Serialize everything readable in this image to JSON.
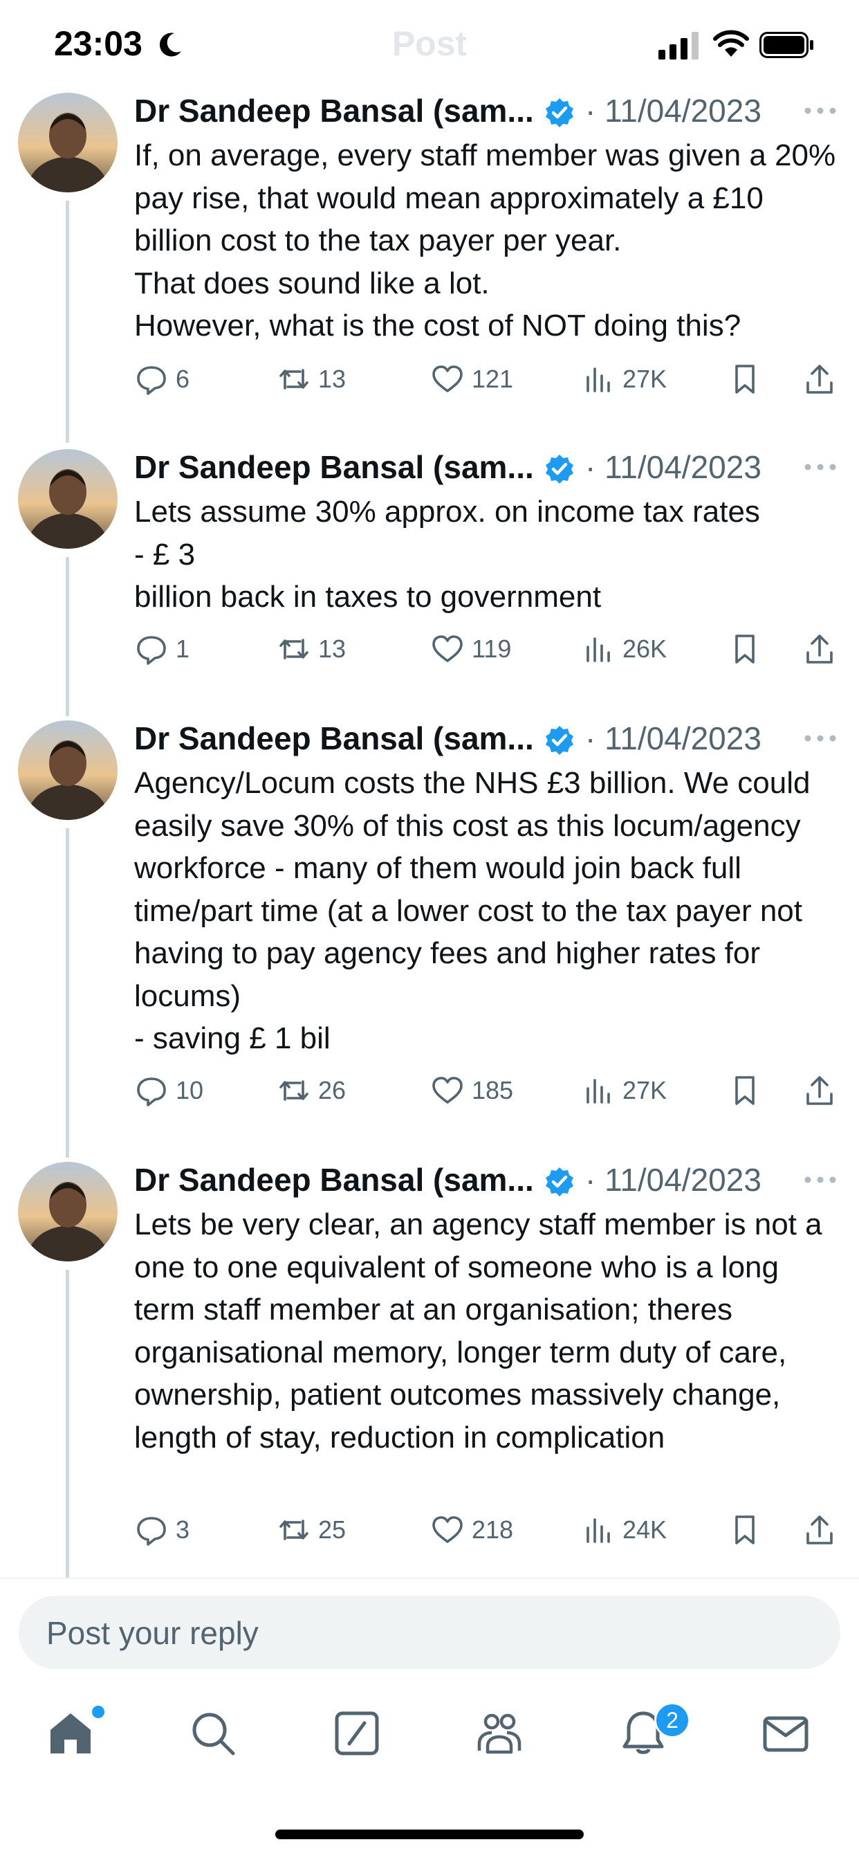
{
  "status_bar": {
    "time": "23:03",
    "header_title": "Post"
  },
  "tweets": [
    {
      "author": "Dr Sandeep Bansal (sam...",
      "date": "· 11/04/2023",
      "text": "If, on average, every staff member was given a 20% pay rise, that would mean approximately a £10 billion cost to the tax payer per year.\nThat does sound like a lot.\nHowever, what is the cost of NOT doing this?",
      "replies": "6",
      "reposts": "13",
      "likes": "121",
      "views": "27K"
    },
    {
      "author": "Dr Sandeep Bansal (sam...",
      "date": "· 11/04/2023",
      "text": "Lets assume 30% approx. on income tax rates\n- £ 3\nbillion back in taxes to government",
      "replies": "1",
      "reposts": "13",
      "likes": "119",
      "views": "26K"
    },
    {
      "author": "Dr Sandeep Bansal (sam...",
      "date": "· 11/04/2023",
      "text": "Agency/Locum costs the NHS £3 billion. We could easily save 30% of this cost as this locum/agency workforce - many of them would join back full time/part time (at a lower cost to the tax payer not having to pay agency fees and higher rates for locums)\n- saving £ 1 bil",
      "replies": "10",
      "reposts": "26",
      "likes": "185",
      "views": "27K"
    },
    {
      "author": "Dr Sandeep Bansal (sam...",
      "date": "· 11/04/2023",
      "text": "Lets be very clear, an agency staff member is not a one to one equivalent of someone who is a long term staff member at an organisation; theres organisational memory, longer term duty of care, ownership, patient outcomes massively change, length of stay, reduction in complication",
      "replies": "3",
      "reposts": "25",
      "likes": "218",
      "views": "24K"
    }
  ],
  "reply": {
    "placeholder": "Post your reply"
  },
  "nav": {
    "notifications_badge": "2"
  },
  "colors": {
    "accent": "#1d9bf0",
    "muted": "#536471",
    "text": "#0f1419"
  }
}
